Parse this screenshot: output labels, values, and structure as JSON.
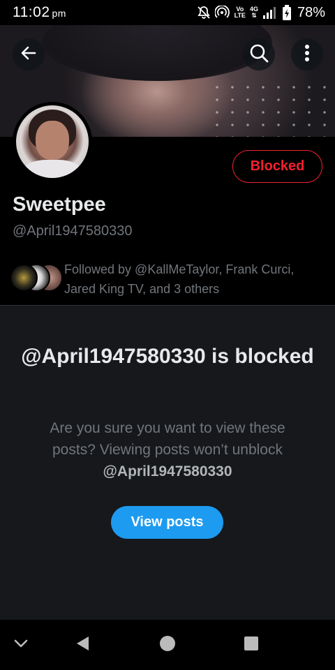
{
  "status_bar": {
    "time": "11:02",
    "ampm": "pm",
    "volte_top": "Vo",
    "volte_bottom": "LTE",
    "network": "4G",
    "battery_percent": "78%"
  },
  "header": {
    "icons": [
      "back-arrow-icon",
      "search-icon",
      "more-vertical-icon"
    ]
  },
  "profile": {
    "display_name": "Sweetpee",
    "handle": "@April1947580330",
    "blocked_label": "Blocked",
    "followed_by": "Followed by @KallMeTaylor, Frank Curci, Jared King TV, and 3 others"
  },
  "blocked_notice": {
    "title": "@April1947580330 is blocked",
    "description": "Are you sure you want to view these posts? Viewing posts won’t unblock",
    "description_handle": "@April1947580330",
    "view_button": "View posts"
  },
  "nav_bar": {
    "icons": [
      "chevron-down-icon",
      "back-triangle-icon",
      "home-circle-icon",
      "recents-square-icon"
    ]
  },
  "colors": {
    "accent_blue": "#1d9bf0",
    "blocked_red": "#f4212e",
    "panel_bg": "#16181c",
    "secondary_text": "#71767b"
  }
}
